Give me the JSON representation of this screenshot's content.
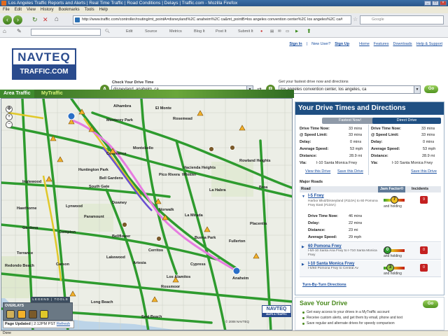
{
  "window": {
    "title": "Los Angeles Traffic Reports and Alerts | Real Time Traffic | Road Conditions | Delays | Traffic.com - Mozilla Firefox"
  },
  "menu": [
    "File",
    "Edit",
    "View",
    "History",
    "Bookmarks",
    "Tools",
    "Help"
  ],
  "browser": {
    "url": "http://www.traffic.com/controller/routing/mt_pointA=disneyland%2C anaheim%2C ca&mt_pointB=los angeles convention center%2C los angeles%2C ca#",
    "search_placeholder": "Google",
    "toolbar_items": [
      "Edit",
      "Source",
      "Metrics",
      "Blog It",
      "Post It",
      "Submit It"
    ]
  },
  "site": {
    "logo_top": "NAVTEQ",
    "logo_bottom": "TRAFFIC.COM",
    "links": [
      "Sign In",
      "New User?",
      "Sign Up",
      "Home",
      "Features",
      "Downloads",
      "Help & Support"
    ]
  },
  "route": {
    "check_label": "Check Your Drive Time",
    "fastest_label": "Get your fastest drive now and directions",
    "point_a": "A",
    "point_b": "B",
    "from": "disneyland, anaheim, ca",
    "to": "los angeles convention center, los angeles, ca",
    "go": "Go"
  },
  "tabs": {
    "area": "Area Traffic",
    "my": "MyTraffic"
  },
  "map": {
    "places": [
      "Alhambra",
      "Monterey Park",
      "Montebello",
      "Pico Rivera",
      "Whittier",
      "Hacienda Heights",
      "Rowland Heights",
      "Inglewood",
      "Huntington Park",
      "South Gate",
      "Downey",
      "Norwalk",
      "La Mirada",
      "La Habra",
      "Brea",
      "Fullerton",
      "Hawthorne",
      "Gardena",
      "Compton",
      "Bellflower",
      "Lakewood",
      "Cerritos",
      "Buena Park",
      "Anaheim",
      "Torrance",
      "Long Beach",
      "Seal Beach",
      "Rossmoor",
      "Los Alamitos",
      "Carson",
      "Redondo Beach",
      "Artesia",
      "El Monte",
      "Rosemead",
      "Commerce",
      "Lynwood",
      "Paramount",
      "Bell Gardens",
      "Cypress",
      "Placentia"
    ],
    "overlays_label": "OVERLAYS",
    "legend_label": "LEGEND | TOOLS",
    "updated_label": "Page Updated",
    "updated_time": "2:12PM PST",
    "refresh": "Refresh",
    "brand": "NAVTEQ",
    "brand_sub": "MAPS & TRAFFIC",
    "copyright": "© 2008 NAVTEQ"
  },
  "panel": {
    "title": "Your Drive Times and Directions",
    "fastest_now": "Fastest Now!",
    "direct_drive": "Direct Drive",
    "left": {
      "drive_time": "33 mins",
      "speed_limit": "33 mins",
      "delay": "0 mins",
      "avg_speed": "53 mph",
      "distance": "28.9 mi",
      "via": "I-10 Santa Monica Frwy"
    },
    "right": {
      "drive_time": "33 mins",
      "speed_limit": "33 mins",
      "delay": "0 mins",
      "avg_speed": "53 mph",
      "distance": "28.9 mi",
      "via": "I-10 Santa Monica Frwy"
    },
    "labels": {
      "drive_time": "Drive Time Now:",
      "speed_limit": "@ Speed Limit:",
      "delay": "Delay:",
      "avg_speed": "Average Speed:",
      "distance": "Distance:",
      "via": "Via:"
    },
    "view_drive": "View this Drive",
    "save_drive": "Save this Drive",
    "major_roads": "Major Roads",
    "cols": {
      "road": "Road",
      "jam": "Jam Factor®",
      "incidents": "Incidents"
    },
    "roads": [
      {
        "name": "I-5 Frwy",
        "sub": "Harbor Blvd/Disneyland (#110A) to 60 Pomona Frwy East (#134A)",
        "jam": "7",
        "trend": "and holding",
        "incidents": "9"
      },
      {
        "name": "60 Pomona Frwy",
        "sub": "I-5/I-10 Santa Ana Frwy to I-710 Santa Monica Frwy",
        "jam": "0",
        "trend": "and holding",
        "incidents": "0"
      },
      {
        "name": "I-10 Santa Monica Frwy",
        "sub": "I-5/60 Pomona Frwy to Central Av",
        "jam": "3",
        "trend": "and holding",
        "incidents": "0"
      }
    ],
    "detail": {
      "drive_time_label": "Drive Time Now:",
      "drive_time": "46 mins",
      "delay_label": "Delay:",
      "delay": "22 mins",
      "distance_label": "Distance:",
      "distance": "23 mi",
      "avg_label": "Average Speed:",
      "avg": "29 mph"
    },
    "turn_by_turn": "Turn-By-Turn Directions"
  },
  "save": {
    "title": "Save Your Drive",
    "go": "Go",
    "bullets": [
      "Get easy access to your drives in a MyTraffic account",
      "Receive custom alerts, and get them by email, phone and text",
      "Save regular and alternate drives for speedy comparison"
    ]
  },
  "status": "Done"
}
